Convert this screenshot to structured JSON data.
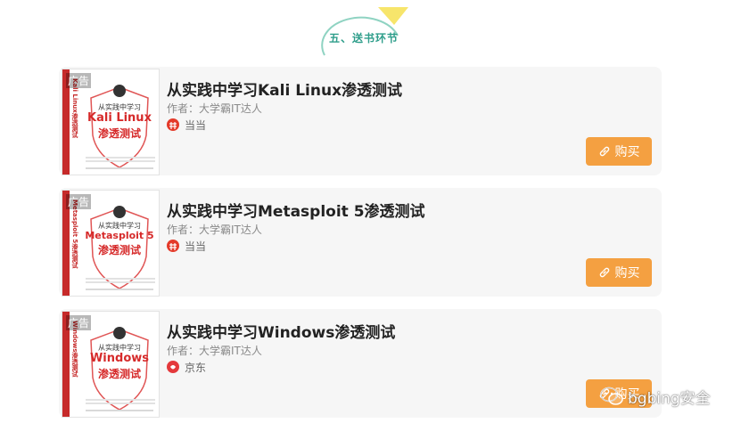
{
  "section": {
    "badge_text": "五、送书环节"
  },
  "colors": {
    "accent": "#f4a041",
    "badge_ring": "#8fd3c2",
    "title": "#222222"
  },
  "cards": [
    {
      "ad_tag": "广告",
      "cover": {
        "subtitle": "从实践中学习",
        "main": "Kali Linux",
        "main2": "渗透测试",
        "spine": "Kali Linux渗透测试"
      },
      "title": "从实践中学习Kali Linux渗透测试",
      "author": "作者：大学霸IT达人",
      "shop": {
        "icon": "dangdang-icon",
        "name": "当当"
      },
      "buy_label": "购买"
    },
    {
      "ad_tag": "广告",
      "cover": {
        "subtitle": "从实践中学习",
        "main": "Metasploit 5",
        "main2": "渗透测试",
        "spine": "Metasploit 5渗透测试"
      },
      "title": "从实践中学习Metasploit 5渗透测试",
      "author": "作者：大学霸IT达人",
      "shop": {
        "icon": "dangdang-icon",
        "name": "当当"
      },
      "buy_label": "购买"
    },
    {
      "ad_tag": "广告",
      "cover": {
        "subtitle": "从实践中学习",
        "main": "Windows",
        "main2": "渗透测试",
        "spine": "Windows渗透测试"
      },
      "title": "从实践中学习Windows渗透测试",
      "author": "作者：大学霸IT达人",
      "shop": {
        "icon": "jd-icon",
        "name": "京东"
      },
      "buy_label": "购买"
    }
  ],
  "watermark": {
    "icon": "wechat-icon",
    "text": "bgbing安全"
  }
}
